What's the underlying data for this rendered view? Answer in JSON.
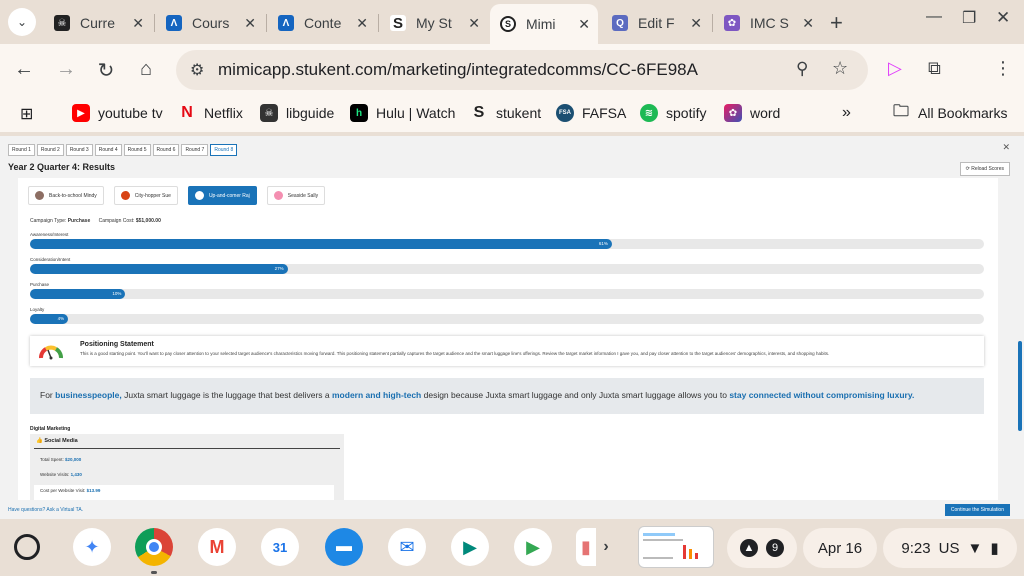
{
  "browser": {
    "tabs": [
      {
        "title": "Curre",
        "favicon": "red-pirate-icon",
        "color": "#222222",
        "active": false
      },
      {
        "title": "Cours",
        "favicon": "stukent-a-icon",
        "color": "#1565c0",
        "active": false
      },
      {
        "title": "Conte",
        "favicon": "stukent-a-icon",
        "color": "#1565c0",
        "active": false
      },
      {
        "title": "My St",
        "favicon": "stukent-s-icon",
        "color": "#222222",
        "active": false
      },
      {
        "title": "Mimi",
        "favicon": "mimic-icon",
        "color": "#222222",
        "active": true
      },
      {
        "title": "Edit F",
        "favicon": "quiz-icon",
        "color": "#5c6bc0",
        "active": false
      },
      {
        "title": "IMC S",
        "favicon": "badge-icon",
        "color": "#7e57c2",
        "active": false
      }
    ],
    "url": "mimicapp.stukent.com/marketing/integratedcomms/CC-6FE98A",
    "bookmarks": [
      {
        "label": "youtube tv",
        "icon": "youtube-icon",
        "color": "#ff0000"
      },
      {
        "label": "Netflix",
        "icon": "netflix-icon",
        "color": "#e50914"
      },
      {
        "label": "libguide",
        "icon": "libguide-icon",
        "color": "#333333"
      },
      {
        "label": "Hulu | Watch",
        "icon": "hulu-icon",
        "color": "#000000"
      },
      {
        "label": "stukent",
        "icon": "stukent-icon",
        "color": "#222222"
      },
      {
        "label": "FAFSA",
        "icon": "fafsa-icon",
        "color": "#1b5e20"
      },
      {
        "label": "spotify",
        "icon": "spotify-icon",
        "color": "#1db954"
      },
      {
        "label": "word",
        "icon": "copilot-icon",
        "color": "#8e24aa"
      }
    ],
    "all_bookmarks": "All Bookmarks"
  },
  "sim": {
    "rounds": [
      "Round 1",
      "Round 2",
      "Round 3",
      "Round 4",
      "Round 5",
      "Round 6",
      "Round 7",
      "Round 8"
    ],
    "current_round": 7,
    "title": "Year 2 Quarter 4: Results",
    "reload_label": "⟳ Reload Scores",
    "personas": [
      {
        "name": "Back-to-school Mindy",
        "color": "#8d6e63",
        "active": false
      },
      {
        "name": "City-hopper Sue",
        "color": "#d84315",
        "active": false
      },
      {
        "name": "Up-and-comer Raj",
        "color": "#795548",
        "active": true
      },
      {
        "name": "Seaside Sally",
        "color": "#f48fb1",
        "active": false
      }
    ],
    "campaign_type_label": "Campaign Type:",
    "campaign_type": "Purchase",
    "campaign_cost_label": "Campaign Cost:",
    "campaign_cost": "$51,000.00",
    "metrics": [
      {
        "label": "Awareness/Interest",
        "value": 61,
        "text": "61%"
      },
      {
        "label": "Consideration/Intent",
        "value": 27,
        "text": "27%"
      },
      {
        "label": "Purchase",
        "value": 10,
        "text": "10%"
      },
      {
        "label": "Loyalty",
        "value": 4,
        "text": "4%"
      }
    ],
    "positioning_title": "Positioning Statement",
    "positioning_text": "This is a good starting point. You'll want to pay closer attention to your selected target audience's characteristics moving forward. This positioning statement partially captures the target audience and the smart luggage line's offerings. Review the target market information I gave you, and pay closer attention to the target audiences' demographics, interests, and shopping habits.",
    "statement": {
      "s1": "For ",
      "h1": "businesspeople,",
      "s2": " Juxta smart luggage is the luggage that best delivers a ",
      "h2": "modern and high-tech",
      "s3": " design because Juxta smart luggage and only Juxta smart luggage allows you to ",
      "h3": "stay connected without compromising luxury."
    },
    "digital_marketing_title": "Digital Marketing",
    "social_media_title": "Social Media",
    "total_spent_label": "Total Spent:",
    "total_spent": "$20,000",
    "website_visits_label": "Website Visits:",
    "website_visits": "1,430",
    "cost_per_visit_label": "Cost per Website Visit:",
    "cost_per_visit": "$13.99",
    "help_link": "Have questions? Ask a Virtual TA.",
    "continue_label": "Continue the Simulation"
  },
  "shelf": {
    "apps": [
      {
        "name": "gemini-icon",
        "color": "#4285f4",
        "glyph": "✦"
      },
      {
        "name": "chrome-icon",
        "color": "#db4437",
        "glyph": "●"
      },
      {
        "name": "gmail-icon",
        "color": "#ea4335",
        "glyph": "M"
      },
      {
        "name": "calendar-icon",
        "color": "#1a73e8",
        "glyph": "31"
      },
      {
        "name": "files-icon",
        "color": "#1e88e5",
        "glyph": "▬"
      },
      {
        "name": "messages-icon",
        "color": "#1a73e8",
        "glyph": "✉"
      },
      {
        "name": "meet-icon",
        "color": "#00897b",
        "glyph": "▶"
      },
      {
        "name": "play-store-icon",
        "color": "#34a853",
        "glyph": "▶"
      }
    ],
    "notif_count": "9",
    "date": "Apr 16",
    "time": "9:23",
    "locale": "US"
  }
}
